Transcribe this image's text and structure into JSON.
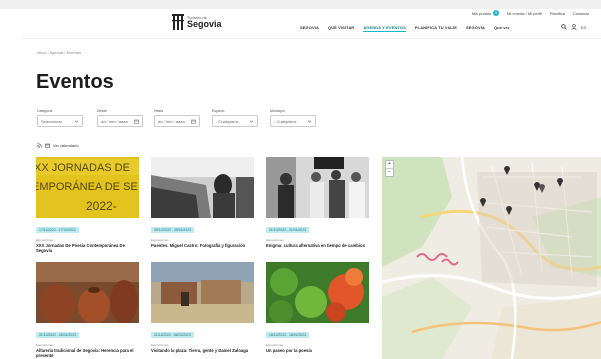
{
  "header": {
    "utility_links": [
      "Mis puntos",
      "Mi cuenta / Mi perfil",
      "Planifica",
      "Contacto"
    ],
    "cart_count": "0",
    "logo": {
      "line1": "Turismo de",
      "line2": "Segovia"
    },
    "nav": [
      {
        "label": "SEGOVIA",
        "active": false
      },
      {
        "label": "QUÉ VISITAR",
        "active": false
      },
      {
        "label": "AGENDA Y EVENTOS",
        "active": true
      },
      {
        "label": "PLANIFICA TU VIAJE",
        "active": false
      },
      {
        "label": "SEGÓVIA",
        "active": false
      },
      {
        "label": "Qué ver",
        "active": false
      }
    ],
    "lang": "ES"
  },
  "breadcrumb": "Inicio / Agenda / Eventos",
  "page_title": "Eventos",
  "filters": [
    {
      "label": "Categoría",
      "value": "Seleccionar"
    },
    {
      "label": "Desde",
      "value": "dd / mm / aaaa"
    },
    {
      "label": "Hasta",
      "value": "dd / mm / aaaa"
    },
    {
      "label": "Espacio",
      "value": "- Cualquiera -"
    },
    {
      "label": "Municipio",
      "value": "- Cualquiera -"
    }
  ],
  "rss_label": "Ver calendario",
  "events": [
    {
      "date": "17/11/2022 - 17/12/2022",
      "category": "Exposiciones",
      "title": "XXX Jornadas De Poesía Contemporánea De Segovia",
      "image": "yellow-poster"
    },
    {
      "date": "09/12/2022 - 09/01/2023",
      "category": "Exposiciones",
      "title": "Puentes. Miguel Castro: Fotografía y figuración",
      "image": "bw-car"
    },
    {
      "date": "01/12/2022 - 01/01/2023",
      "category": "Exposiciones",
      "title": "Enigma: cultura alternativa en tiempo de cambios",
      "image": "bw-people"
    },
    {
      "date": "01/12/2022 - 06/01/2023",
      "category": "Exposiciones",
      "title": "Alfarería tradicional de Segovia: Herencia para el presente",
      "image": "pottery"
    },
    {
      "date": "21/11/2022 - 06/01/2023",
      "category": "Exposiciones",
      "title": "Visitando la plaza: Tierra, gente y Daniel Zuloaga",
      "image": "painting"
    },
    {
      "date": "18/12/2022 - 18/01/2023",
      "category": "Exposiciones",
      "title": "Un paseo por la poesía",
      "image": "plants"
    }
  ],
  "colors": {
    "accent": "#19b6c8",
    "date_bg": "#bfeaf0",
    "date_text": "#1b6f7d"
  }
}
